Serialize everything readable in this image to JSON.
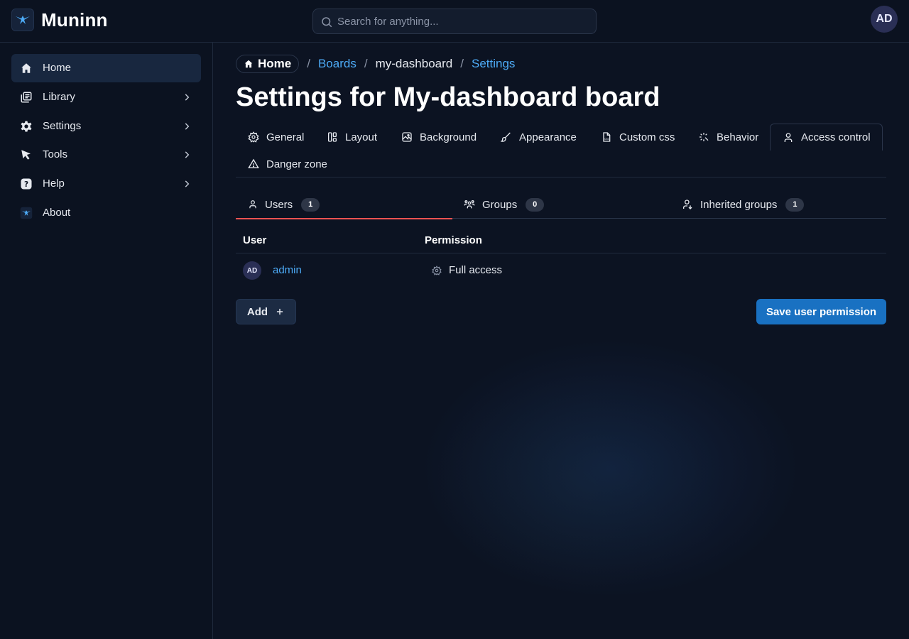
{
  "app": {
    "name": "Muninn",
    "avatar_initials": "AD"
  },
  "search": {
    "placeholder": "Search for anything..."
  },
  "sidebar": {
    "items": [
      {
        "label": "Home",
        "icon": "home-icon",
        "active": true
      },
      {
        "label": "Library",
        "icon": "library-icon"
      },
      {
        "label": "Settings",
        "icon": "gear-icon"
      },
      {
        "label": "Tools",
        "icon": "pointer-icon"
      },
      {
        "label": "Help",
        "icon": "question-icon"
      },
      {
        "label": "About",
        "icon": "logo-icon"
      }
    ]
  },
  "breadcrumb": {
    "home": "Home",
    "sep": "/",
    "boards": "Boards",
    "board": "my-dashboard",
    "settings": "Settings"
  },
  "page": {
    "title": "Settings for My-dashboard board"
  },
  "tabs": [
    {
      "label": "General",
      "icon": "gear-icon"
    },
    {
      "label": "Layout",
      "icon": "layout-icon"
    },
    {
      "label": "Background",
      "icon": "image-icon"
    },
    {
      "label": "Appearance",
      "icon": "brush-icon"
    },
    {
      "label": "Custom css",
      "icon": "file-css-icon"
    },
    {
      "label": "Behavior",
      "icon": "sparkle-icon"
    },
    {
      "label": "Access control",
      "icon": "user-icon",
      "active": true
    },
    {
      "label": "Danger zone",
      "icon": "alert-triangle-icon"
    }
  ],
  "subtabs": [
    {
      "label": "Users",
      "count": "1",
      "icon": "user-icon",
      "active": true
    },
    {
      "label": "Groups",
      "count": "0",
      "icon": "users-group-icon"
    },
    {
      "label": "Inherited groups",
      "count": "1",
      "icon": "user-down-icon"
    }
  ],
  "table": {
    "headers": {
      "user": "User",
      "permission": "Permission"
    },
    "rows": [
      {
        "avatar": "AD",
        "user": "admin",
        "permission": "Full access",
        "permission_icon": "settings-icon"
      }
    ]
  },
  "actions": {
    "add": "Add",
    "save": "Save user permission"
  },
  "colors": {
    "accent": "#4dabf7",
    "primary_button": "#1971c2",
    "active_tab_indicator": "#fa5252"
  }
}
